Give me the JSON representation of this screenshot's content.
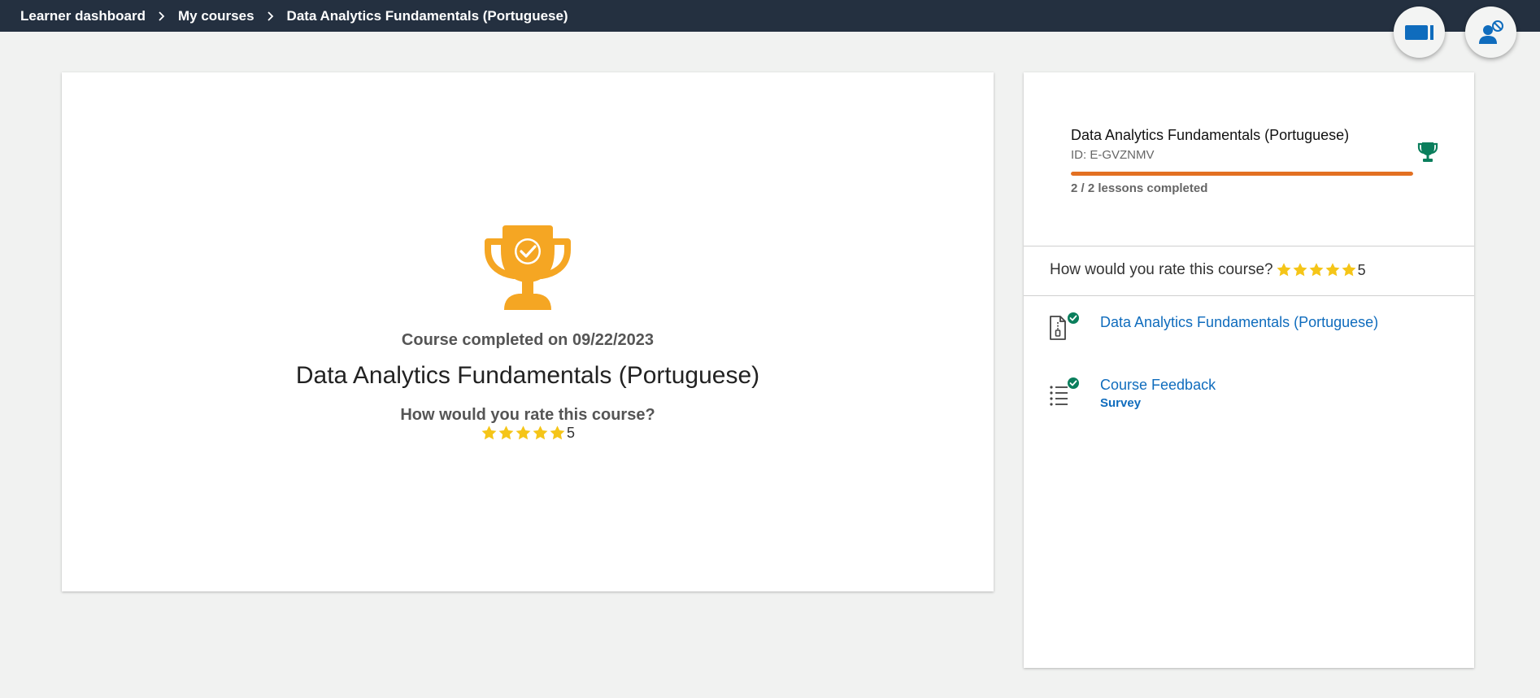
{
  "breadcrumb": {
    "items": [
      "Learner dashboard",
      "My courses",
      "Data Analytics Fundamentals (Portuguese)"
    ]
  },
  "header_actions": {
    "video_icon": "video-camera-icon",
    "user_icon": "user-blocked-icon"
  },
  "completion": {
    "completed_text": "Course completed on 09/22/2023",
    "course_title": "Data Analytics Fundamentals (Portuguese)",
    "rating_question": "How would you rate this course?",
    "stars": 5,
    "rating_value": "5"
  },
  "sidebar": {
    "course_title": "Data Analytics Fundamentals (Portuguese)",
    "course_id": "ID: E-GVZNMV",
    "progress_fraction": 1.0,
    "lessons_text": "2 / 2 lessons completed",
    "rating_question": "How would you rate this course?",
    "rating_value": "5",
    "items": [
      {
        "title": "Data Analytics Fundamentals (Portuguese)",
        "subtitle": "",
        "icon": "zip-file-icon",
        "status": "completed"
      },
      {
        "title": "Course Feedback",
        "subtitle": "Survey",
        "icon": "list-icon",
        "status": "completed"
      }
    ]
  },
  "colors": {
    "topbar": "#243040",
    "trophy_gold": "#f5a623",
    "star": "#f5c518",
    "progress": "#e37022",
    "link": "#0f6cbd",
    "success": "#0a7e5c"
  }
}
